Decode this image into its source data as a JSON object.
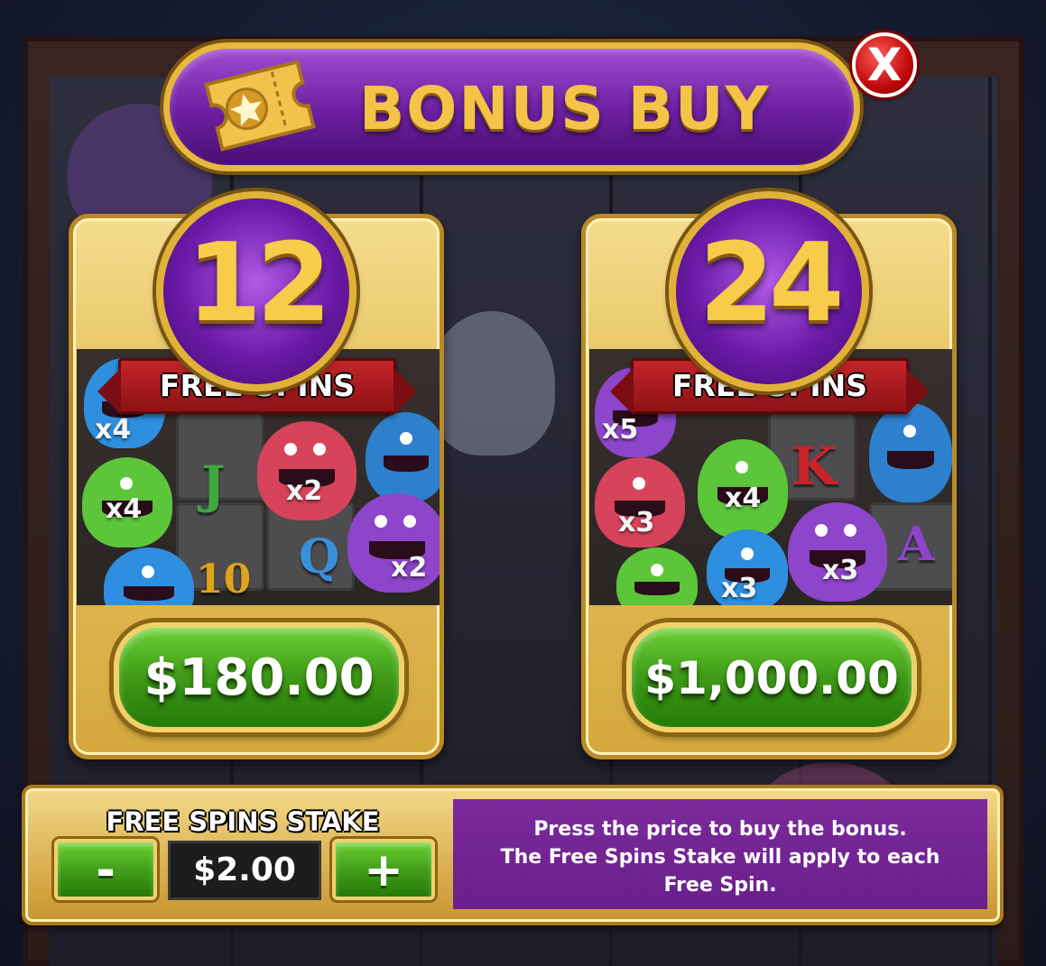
{
  "header": {
    "title": "BONUS BUY",
    "ticket_icon": "ticket-star-icon"
  },
  "close": {
    "label": "X"
  },
  "options": [
    {
      "spins": "12",
      "label": "FREE SPINS",
      "price": "$180.00",
      "multipliers": [
        "x4",
        "x4",
        "x2",
        "x2"
      ],
      "symbols": [
        "J",
        "10",
        "Q"
      ]
    },
    {
      "spins": "24",
      "label": "FREE SPINS",
      "price": "$1,000.00",
      "multipliers": [
        "x5",
        "x3",
        "x4",
        "x3",
        "x3"
      ],
      "symbols": [
        "K",
        "A"
      ]
    }
  ],
  "stake": {
    "label": "FREE SPINS STAKE",
    "minus": "-",
    "value": "$2.00",
    "plus": "+"
  },
  "info": {
    "line1": "Press the price to buy the bonus.",
    "line2": "The Free Spins Stake will apply to each",
    "line3": "Free Spin."
  },
  "colors": {
    "gold": "#e6b83d",
    "purple": "#6c1fa0",
    "green": "#3f9b18",
    "red": "#c00a0a"
  }
}
